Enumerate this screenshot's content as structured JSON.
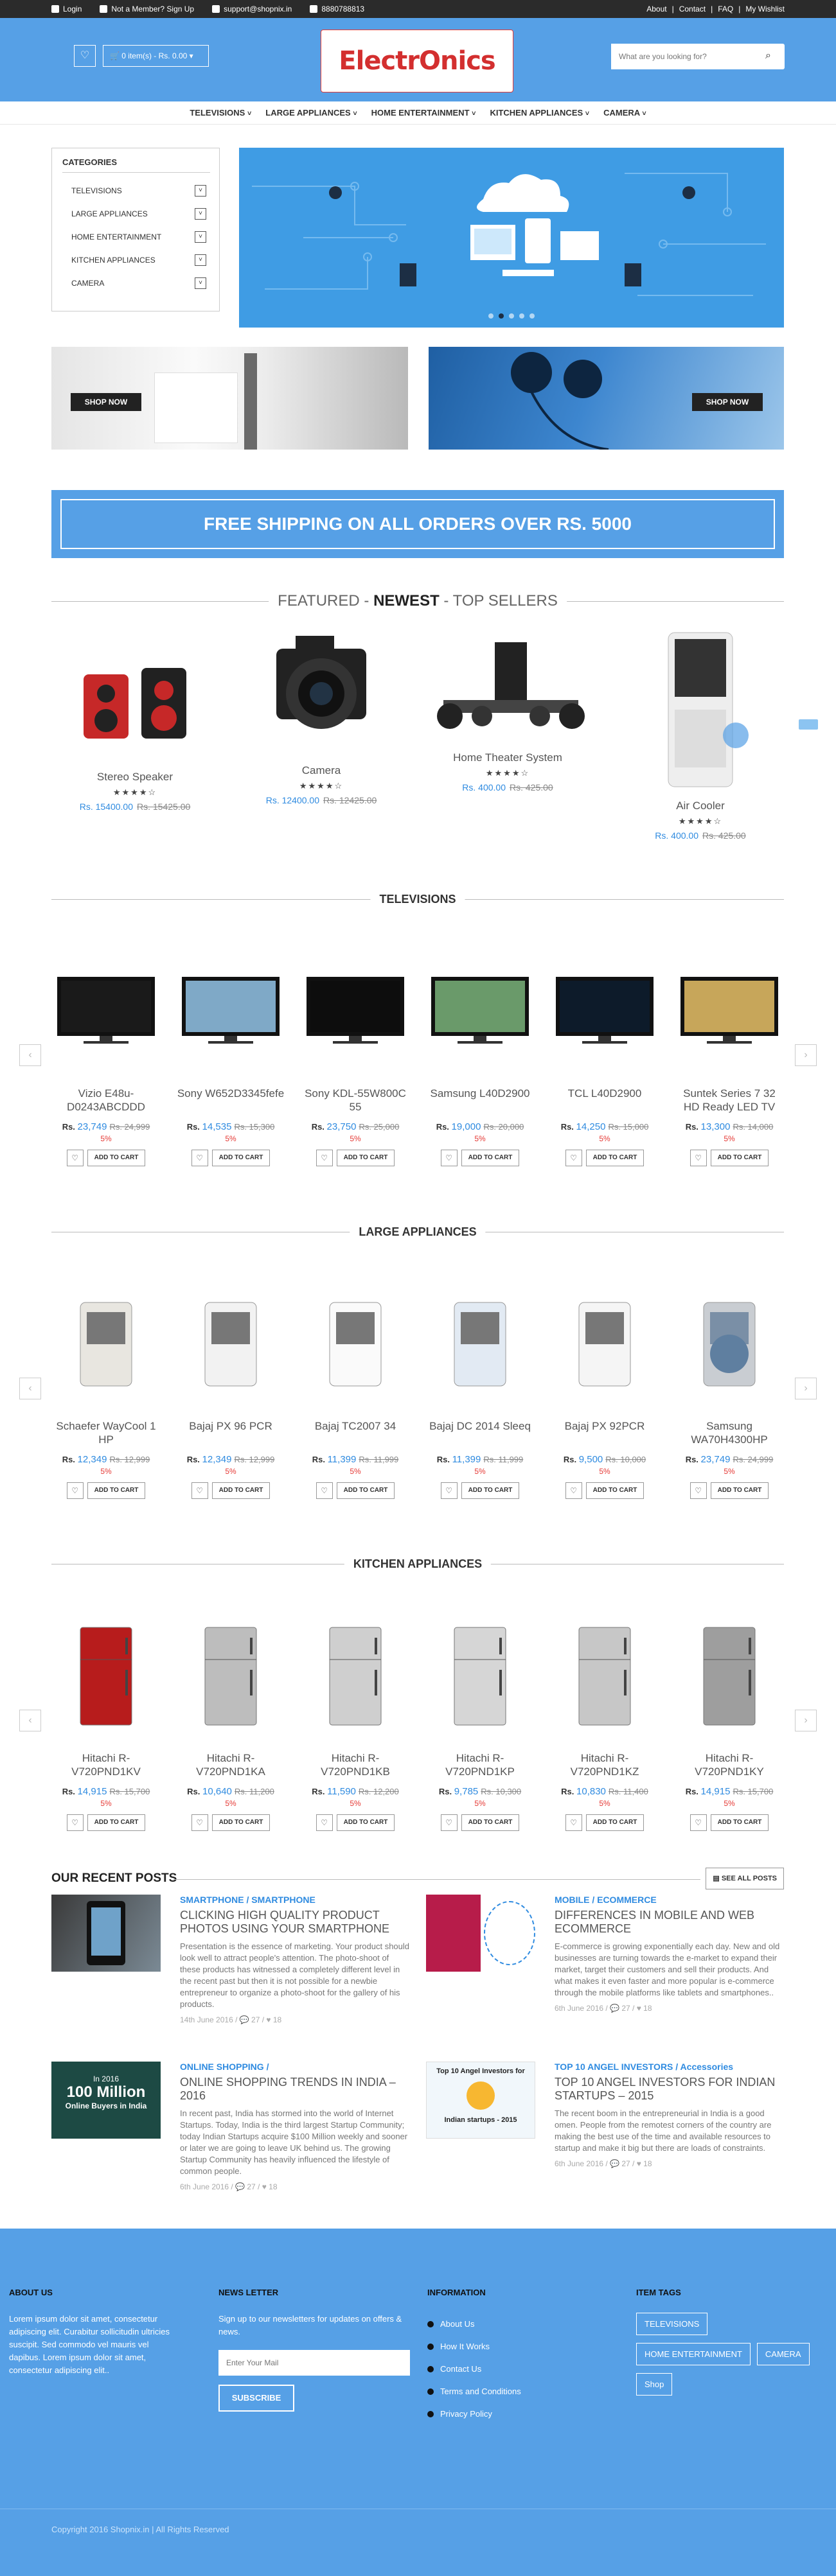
{
  "topbar": {
    "login": "Login",
    "member": "Not a Member? Sign Up",
    "email": "support@shopnix.in",
    "phone": "8880788813",
    "links": [
      "About",
      "|",
      "Contact",
      "|",
      "FAQ",
      "|",
      "My Wishlist"
    ]
  },
  "header": {
    "wishlist_icon": "heart-icon",
    "cart": "0 item(s) - Rs. 0.00",
    "logo": "ElectrOnics",
    "search_placeholder": "What are you looking for?"
  },
  "nav": [
    "TELEVISIONS",
    "LARGE APPLIANCES",
    "HOME ENTERTAINMENT",
    "KITCHEN APPLIANCES",
    "CAMERA"
  ],
  "categories": {
    "title": "CATEGORIES",
    "items": [
      "TELEVISIONS",
      "LARGE APPLIANCES",
      "HOME ENTERTAINMENT",
      "KITCHEN APPLIANCES",
      "CAMERA"
    ]
  },
  "banners": {
    "shop_now": "SHOP NOW"
  },
  "free_shipping": "FREE SHIPPING ON ALL ORDERS OVER RS. 5000",
  "tabs": {
    "featured": "FEATURED",
    "sep": "-",
    "newest": "NEWEST",
    "top": "TOP SELLERS"
  },
  "featured": [
    {
      "name": "Stereo Speaker",
      "price": "Rs. 15400.00",
      "old": "Rs. 15425.00",
      "stars": "★★★★☆"
    },
    {
      "name": "Camera",
      "price": "Rs. 12400.00",
      "old": "Rs. 12425.00",
      "stars": "★★★★☆"
    },
    {
      "name": "Home Theater System",
      "price": "Rs. 400.00",
      "old": "Rs. 425.00",
      "stars": "★★★★☆"
    },
    {
      "name": "Air Cooler",
      "price": "Rs. 400.00",
      "old": "Rs. 425.00",
      "stars": "★★★★☆"
    }
  ],
  "sections": {
    "tv": {
      "title": "TELEVISIONS",
      "items": [
        {
          "name": "Vizio E48u-D0243ABCDDD",
          "new": "23,749",
          "old": "Rs. 24,999",
          "off": "5%"
        },
        {
          "name": "Sony W652D3345fefe",
          "new": "14,535",
          "old": "Rs. 15,300",
          "off": "5%"
        },
        {
          "name": "Sony KDL-55W800C 55",
          "new": "23,750",
          "old": "Rs. 25,000",
          "off": "5%"
        },
        {
          "name": "Samsung L40D2900",
          "new": "19,000",
          "old": "Rs. 20,000",
          "off": "5%"
        },
        {
          "name": "TCL L40D2900",
          "new": "14,250",
          "old": "Rs. 15,000",
          "off": "5%"
        },
        {
          "name": "Suntek Series 7 32 HD Ready LED TV",
          "new": "13,300",
          "old": "Rs. 14,000",
          "off": "5%"
        }
      ]
    },
    "large": {
      "title": "LARGE APPLIANCES",
      "items": [
        {
          "name": "Schaefer WayCool 1 HP",
          "new": "12,349",
          "old": "Rs. 12,999",
          "off": "5%"
        },
        {
          "name": "Bajaj PX 96 PCR",
          "new": "12,349",
          "old": "Rs. 12,999",
          "off": "5%"
        },
        {
          "name": "Bajaj TC2007 34",
          "new": "11,399",
          "old": "Rs. 11,999",
          "off": "5%"
        },
        {
          "name": "Bajaj DC 2014 Sleeq",
          "new": "11,399",
          "old": "Rs. 11,999",
          "off": "5%"
        },
        {
          "name": "Bajaj PX 92PCR",
          "new": "9,500",
          "old": "Rs. 10,000",
          "off": "5%"
        },
        {
          "name": "Samsung WA70H4300HP",
          "new": "23,749",
          "old": "Rs. 24,999",
          "off": "5%"
        }
      ]
    },
    "kitchen": {
      "title": "KITCHEN APPLIANCES",
      "items": [
        {
          "name": "Hitachi R-V720PND1KV",
          "new": "14,915",
          "old": "Rs. 15,700",
          "off": "5%"
        },
        {
          "name": "Hitachi R-V720PND1KA",
          "new": "10,640",
          "old": "Rs. 11,200",
          "off": "5%"
        },
        {
          "name": "Hitachi R-V720PND1KB",
          "new": "11,590",
          "old": "Rs. 12,200",
          "off": "5%"
        },
        {
          "name": "Hitachi R-V720PND1KP",
          "new": "9,785",
          "old": "Rs. 10,300",
          "off": "5%"
        },
        {
          "name": "Hitachi R-V720PND1KZ",
          "new": "10,830",
          "old": "Rs. 11,400",
          "off": "5%"
        },
        {
          "name": "Hitachi R-V720PND1KY",
          "new": "14,915",
          "old": "Rs. 15,700",
          "off": "5%"
        }
      ]
    }
  },
  "card": {
    "rs": "Rs.",
    "add": "ADD TO CART",
    "heart": "♡"
  },
  "blog": {
    "title": "OUR RECENT POSTS",
    "see_all": "SEE ALL POSTS",
    "posts": [
      {
        "cat": "SMARTPHONE / SMARTPHONE",
        "title": "CLICKING HIGH QUALITY PRODUCT PHOTOS USING YOUR SMARTPHONE",
        "body": "Presentation is the essence of marketing. Your product should look well to attract people's attention. The photo-shoot of these products has witnessed a completely different level in the recent past but then it is not possible for a newbie entrepreneur to organize a photo-shoot for the gallery of his products.",
        "meta": "14th June 2016  /  💬 27  /  ♥ 18"
      },
      {
        "cat": "MOBILE / ECOMMERCE",
        "title": "DIFFERENCES IN MOBILE AND WEB ECOMMERCE",
        "body": "E-commerce is growing exponentially each day. New and old businesses are turning towards the e-market to expand their market, target their customers and sell their products. And what makes it even faster and more popular is e-commerce through the mobile platforms like tablets and smartphones..",
        "meta": "6th June 2016  /  💬 27  /  ♥ 18"
      },
      {
        "cat": "ONLINE SHOPPING /",
        "title": "ONLINE SHOPPING TRENDS IN INDIA – 2016",
        "body": "In recent past, India has stormed into the world of Internet Startups. Today, India is the third largest Startup Community; today Indian Startups acquire $100 Million weekly and sooner or later we are going to leave UK behind us. The growing Startup Community has heavily influenced the lifestyle of common people.",
        "meta": "6th June 2016  /  💬 27  /  ♥ 18",
        "thumb_line1": "In 2016",
        "thumb_line2": "100 Million",
        "thumb_line3": "Online Buyers in India"
      },
      {
        "cat": "TOP 10 ANGEL INVESTORS / Accessories",
        "title": "TOP 10 ANGEL INVESTORS FOR INDIAN STARTUPS – 2015",
        "body": "The recent boom in the entrepreneurial in India is a good omen. People from the remotest corners of the country are making the best use of the time and available resources to startup and make it big but there are loads of constraints.",
        "meta": "6th June 2016  /  💬 27  /  ♥ 18",
        "thumb_line1": "Top 10 Angel Investors for",
        "thumb_line2": "Indian startups - 2015"
      }
    ]
  },
  "footer": {
    "about_title": "ABOUT US",
    "about": "Lorem ipsum dolor sit amet, consectetur adipiscing elit. Curabitur sollicitudin ultricies suscipit. Sed commodo vel mauris vel dapibus. Lorem ipsum dolor sit amet, consectetur adipiscing elit..",
    "news_title": "NEWS LETTER",
    "news_text": "Sign up to our newsletters for updates on offers & news.",
    "mail_placeholder": "Enter Your Mail",
    "subscribe": "SUBSCRIBE",
    "info_title": "INFORMATION",
    "info": [
      "About Us",
      "How It Works",
      "Contact Us",
      "Terms and Conditions",
      "Privacy Policy"
    ],
    "tags_title": "ITEM TAGS",
    "tags": [
      "TELEVISIONS",
      "HOME ENTERTAINMENT",
      "CAMERA",
      "Shop"
    ],
    "copy": "Copyright 2016 Shopnix.in | All Rights Reserved"
  }
}
